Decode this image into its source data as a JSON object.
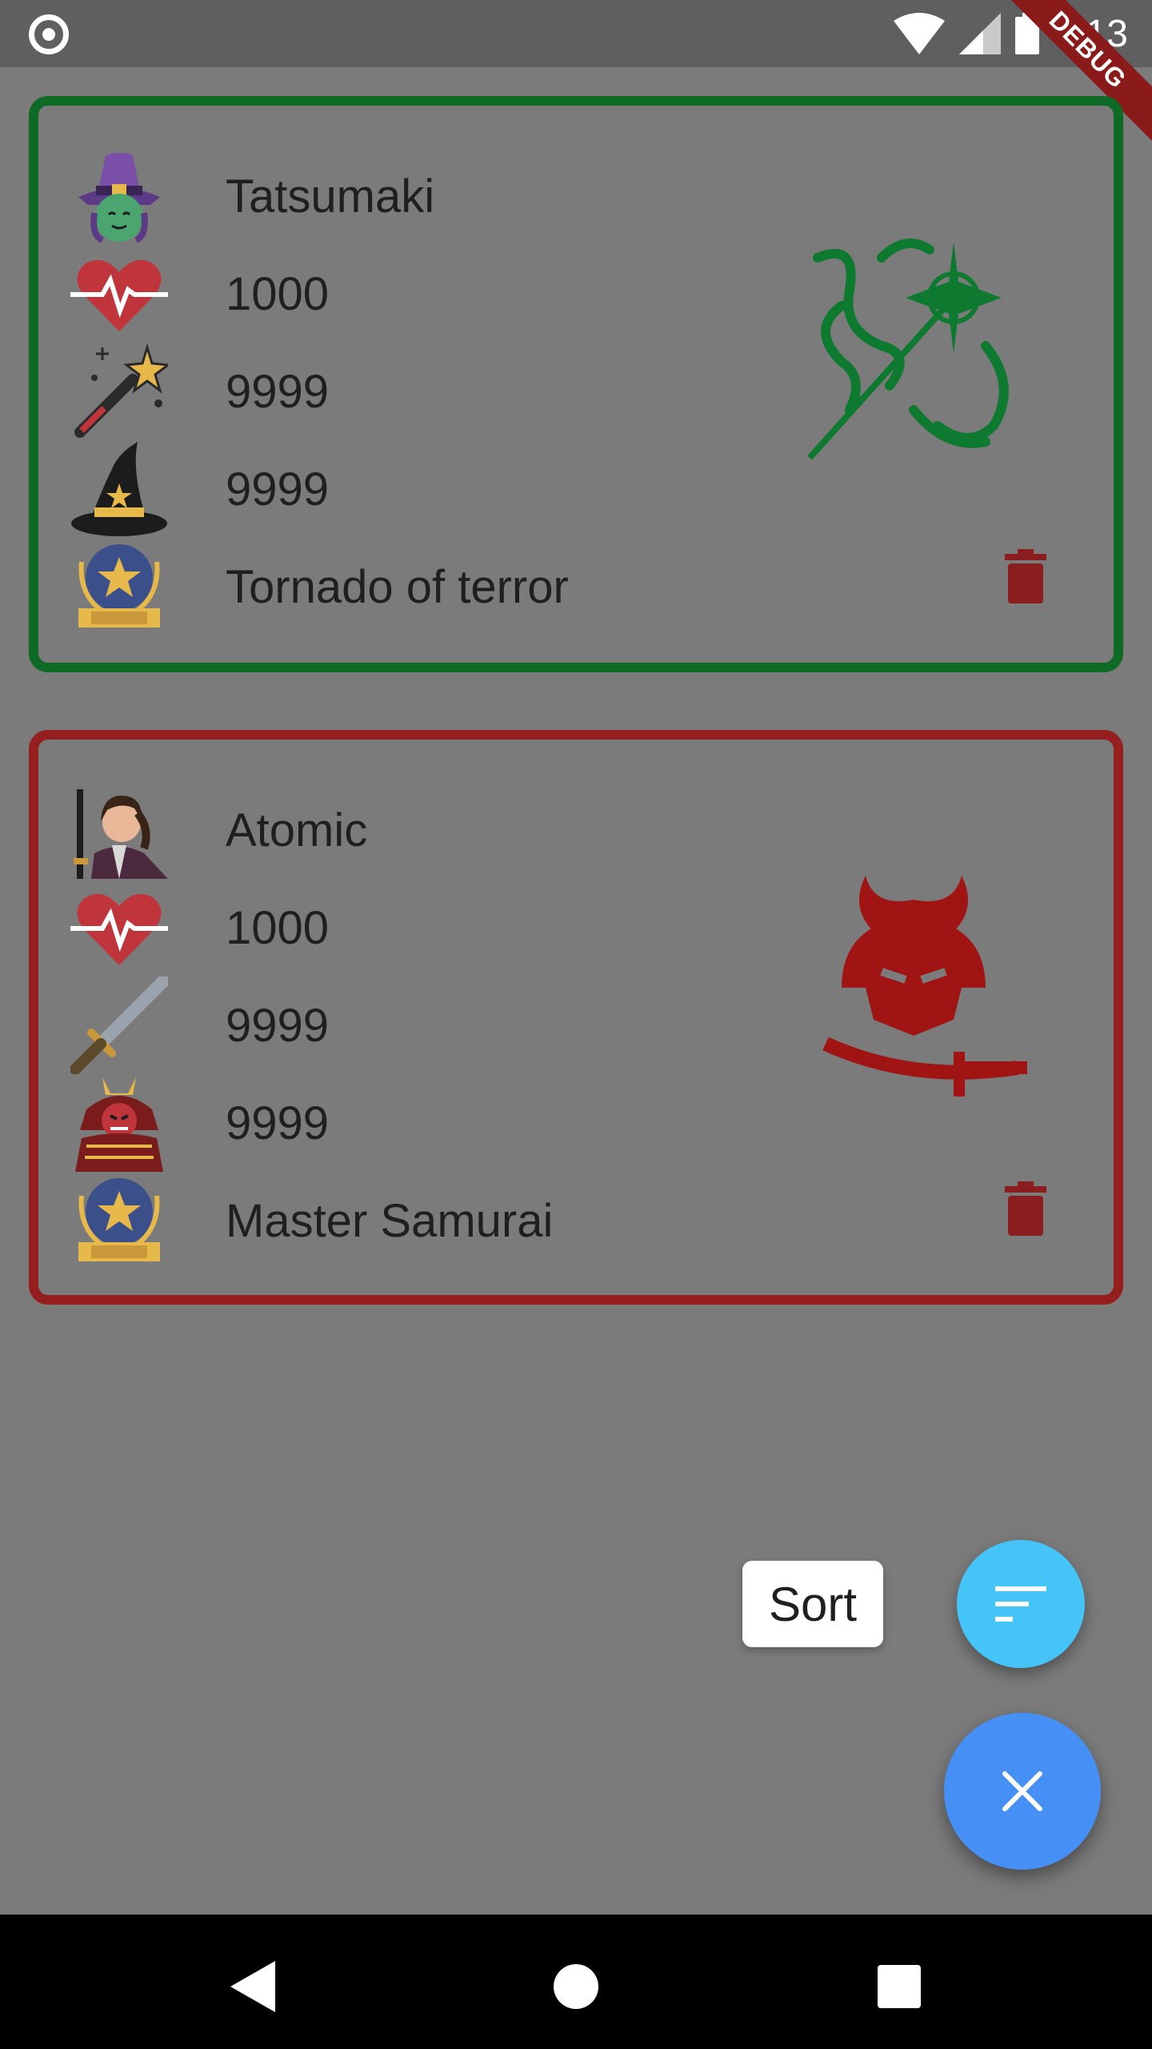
{
  "status_bar": {
    "time": "7:13",
    "debug_banner": "DEBUG",
    "icons": [
      "record-icon",
      "wifi-icon",
      "signal-icon",
      "battery-icon"
    ]
  },
  "heroes": [
    {
      "name": "Tatsumaki",
      "health": "1000",
      "attack": "9999",
      "defense": "9999",
      "rank": "Tornado of terror",
      "border_color": "#0f6a25",
      "emblem": "magic-staff-emblem",
      "icons": [
        "witch-avatar-icon",
        "heart-pulse-icon",
        "magic-wand-icon",
        "witch-hat-icon",
        "rank-badge-icon"
      ]
    },
    {
      "name": "Atomic",
      "health": "1000",
      "attack": "9999",
      "defense": "9999",
      "rank": "Master Samurai",
      "border_color": "#951e1e",
      "emblem": "samurai-helmet-emblem",
      "icons": [
        "samurai-avatar-icon",
        "heart-pulse-icon",
        "katana-icon",
        "samurai-armor-icon",
        "rank-badge-icon"
      ]
    }
  ],
  "fab": {
    "sort_label": "Sort",
    "sort_color": "#45c4f8",
    "close_color": "#4690f5"
  },
  "colors": {
    "scrim": "#7b7b7b",
    "trash": "#8a1e1e"
  }
}
